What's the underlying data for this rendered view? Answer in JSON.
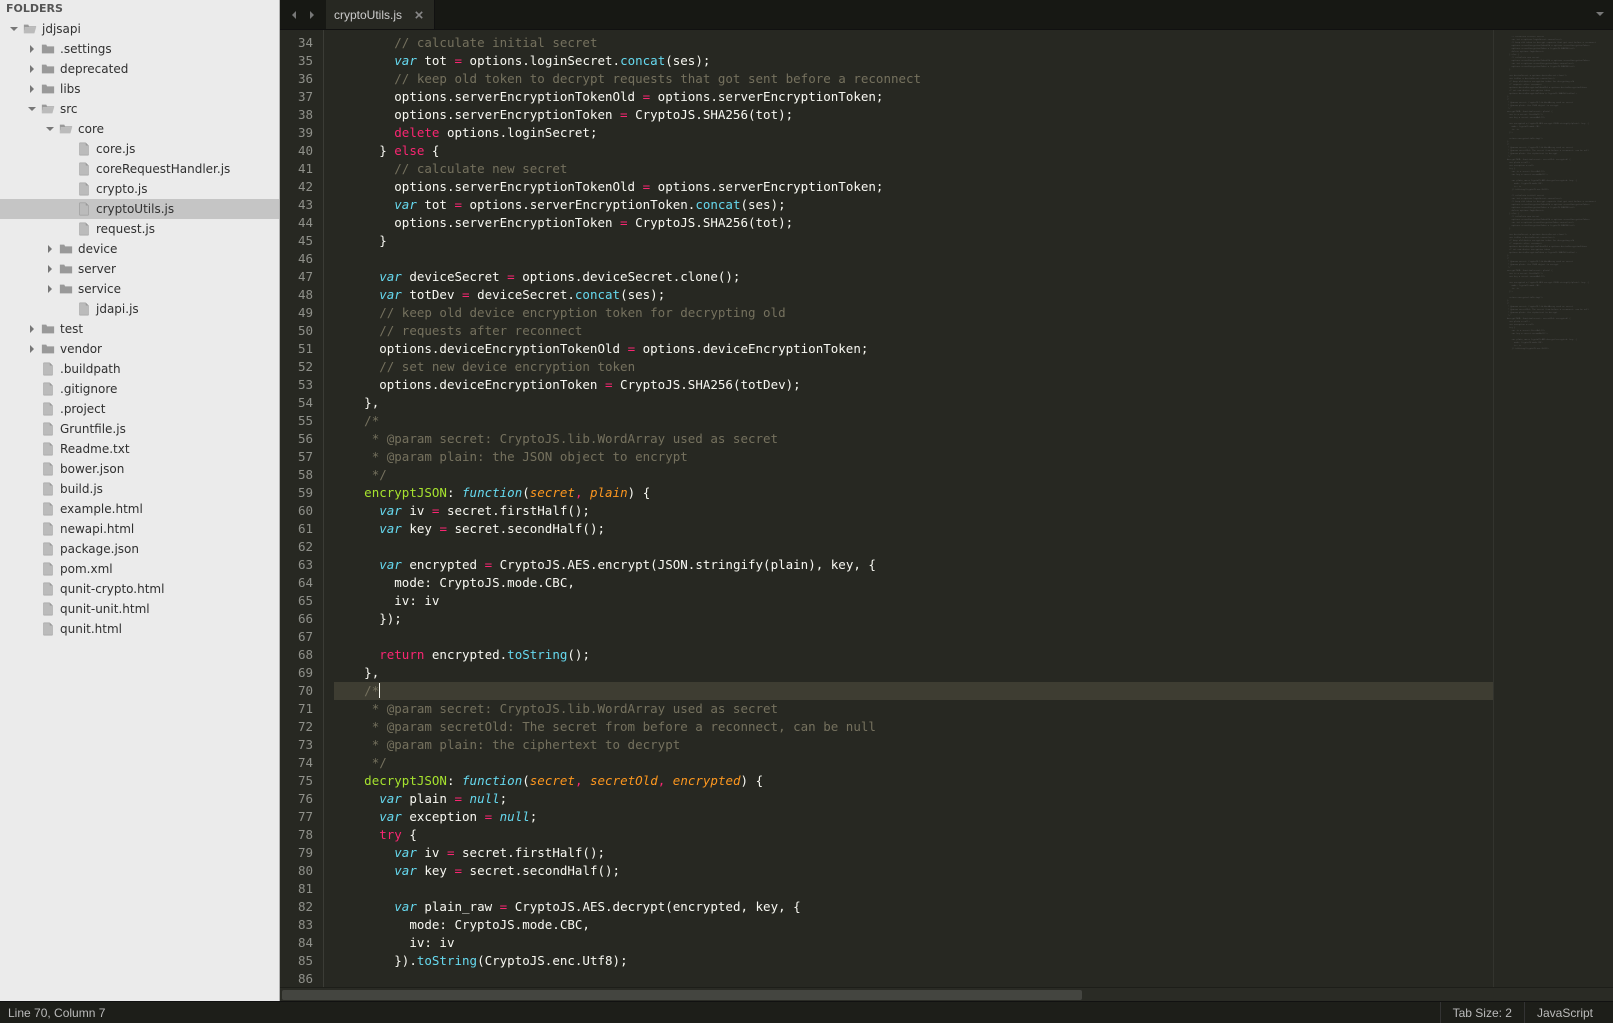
{
  "sidebar": {
    "header": "FOLDERS",
    "tree": [
      {
        "depth": 0,
        "type": "folder",
        "open": true,
        "name": "jdjsapi"
      },
      {
        "depth": 1,
        "type": "folder",
        "open": false,
        "name": ".settings"
      },
      {
        "depth": 1,
        "type": "folder",
        "open": false,
        "name": "deprecated"
      },
      {
        "depth": 1,
        "type": "folder",
        "open": false,
        "name": "libs"
      },
      {
        "depth": 1,
        "type": "folder",
        "open": true,
        "name": "src"
      },
      {
        "depth": 2,
        "type": "folder",
        "open": true,
        "name": "core"
      },
      {
        "depth": 3,
        "type": "file",
        "name": "core.js"
      },
      {
        "depth": 3,
        "type": "file",
        "name": "coreRequestHandler.js"
      },
      {
        "depth": 3,
        "type": "file",
        "name": "crypto.js"
      },
      {
        "depth": 3,
        "type": "file",
        "name": "cryptoUtils.js",
        "selected": true
      },
      {
        "depth": 3,
        "type": "file",
        "name": "request.js"
      },
      {
        "depth": 2,
        "type": "folder",
        "open": false,
        "name": "device"
      },
      {
        "depth": 2,
        "type": "folder",
        "open": false,
        "name": "server"
      },
      {
        "depth": 2,
        "type": "folder",
        "open": false,
        "name": "service"
      },
      {
        "depth": 3,
        "type": "file",
        "name": "jdapi.js"
      },
      {
        "depth": 1,
        "type": "folder",
        "open": false,
        "name": "test"
      },
      {
        "depth": 1,
        "type": "folder",
        "open": false,
        "name": "vendor"
      },
      {
        "depth": 1,
        "type": "file",
        "name": ".buildpath"
      },
      {
        "depth": 1,
        "type": "file",
        "name": ".gitignore"
      },
      {
        "depth": 1,
        "type": "file",
        "name": ".project"
      },
      {
        "depth": 1,
        "type": "file",
        "name": "Gruntfile.js"
      },
      {
        "depth": 1,
        "type": "file",
        "name": "Readme.txt"
      },
      {
        "depth": 1,
        "type": "file",
        "name": "bower.json"
      },
      {
        "depth": 1,
        "type": "file",
        "name": "build.js"
      },
      {
        "depth": 1,
        "type": "file",
        "name": "example.html"
      },
      {
        "depth": 1,
        "type": "file",
        "name": "newapi.html"
      },
      {
        "depth": 1,
        "type": "file",
        "name": "package.json"
      },
      {
        "depth": 1,
        "type": "file",
        "name": "pom.xml"
      },
      {
        "depth": 1,
        "type": "file",
        "name": "qunit-crypto.html"
      },
      {
        "depth": 1,
        "type": "file",
        "name": "qunit-unit.html"
      },
      {
        "depth": 1,
        "type": "file",
        "name": "qunit.html"
      }
    ]
  },
  "tabs": {
    "active": "cryptoUtils.js"
  },
  "editor": {
    "first_line_no": 34,
    "active_line_no": 70,
    "lines": [
      [
        [
          "        ",
          "p"
        ],
        [
          "// calculate initial secret",
          "cmt"
        ]
      ],
      [
        [
          "        ",
          "p"
        ],
        [
          "var",
          "kw"
        ],
        [
          " tot ",
          "p"
        ],
        [
          "=",
          "op"
        ],
        [
          " options.loginSecret.",
          "p"
        ],
        [
          "concat",
          "fn"
        ],
        [
          "(ses);",
          "p"
        ]
      ],
      [
        [
          "        ",
          "p"
        ],
        [
          "// keep old token to decrypt requests that got sent before a reconnect",
          "cmt"
        ]
      ],
      [
        [
          "        options.serverEncryptionTokenOld ",
          "p"
        ],
        [
          "=",
          "op"
        ],
        [
          " options.serverEncryptionToken;",
          "p"
        ]
      ],
      [
        [
          "        options.serverEncryptionToken ",
          "p"
        ],
        [
          "=",
          "op"
        ],
        [
          " CryptoJS.SHA256(tot);",
          "p"
        ]
      ],
      [
        [
          "        ",
          "p"
        ],
        [
          "delete",
          "kw2"
        ],
        [
          " options.loginSecret;",
          "p"
        ]
      ],
      [
        [
          "      } ",
          "p"
        ],
        [
          "else",
          "kw2"
        ],
        [
          " {",
          "p"
        ]
      ],
      [
        [
          "        ",
          "p"
        ],
        [
          "// calculate new secret",
          "cmt"
        ]
      ],
      [
        [
          "        options.serverEncryptionTokenOld ",
          "p"
        ],
        [
          "=",
          "op"
        ],
        [
          " options.serverEncryptionToken;",
          "p"
        ]
      ],
      [
        [
          "        ",
          "p"
        ],
        [
          "var",
          "kw"
        ],
        [
          " tot ",
          "p"
        ],
        [
          "=",
          "op"
        ],
        [
          " options.serverEncryptionToken.",
          "p"
        ],
        [
          "concat",
          "fn"
        ],
        [
          "(ses);",
          "p"
        ]
      ],
      [
        [
          "        options.serverEncryptionToken ",
          "p"
        ],
        [
          "=",
          "op"
        ],
        [
          " CryptoJS.SHA256(tot);",
          "p"
        ]
      ],
      [
        [
          "      }",
          "p"
        ]
      ],
      [
        [
          "",
          "p"
        ]
      ],
      [
        [
          "      ",
          "p"
        ],
        [
          "var",
          "kw"
        ],
        [
          " deviceSecret ",
          "p"
        ],
        [
          "=",
          "op"
        ],
        [
          " options.deviceSecret.clone();",
          "p"
        ]
      ],
      [
        [
          "      ",
          "p"
        ],
        [
          "var",
          "kw"
        ],
        [
          " totDev ",
          "p"
        ],
        [
          "=",
          "op"
        ],
        [
          " deviceSecret.",
          "p"
        ],
        [
          "concat",
          "fn"
        ],
        [
          "(ses);",
          "p"
        ]
      ],
      [
        [
          "      ",
          "p"
        ],
        [
          "// keep old device encryption token for decrypting old",
          "cmt"
        ]
      ],
      [
        [
          "      ",
          "p"
        ],
        [
          "// requests after reconnect",
          "cmt"
        ]
      ],
      [
        [
          "      options.deviceEncryptionTokenOld ",
          "p"
        ],
        [
          "=",
          "op"
        ],
        [
          " options.deviceEncryptionToken;",
          "p"
        ]
      ],
      [
        [
          "      ",
          "p"
        ],
        [
          "// set new device encryption token",
          "cmt"
        ]
      ],
      [
        [
          "      options.deviceEncryptionToken ",
          "p"
        ],
        [
          "=",
          "op"
        ],
        [
          " CryptoJS.SHA256(totDev);",
          "p"
        ]
      ],
      [
        [
          "    },",
          "p"
        ]
      ],
      [
        [
          "    ",
          "p"
        ],
        [
          "/*",
          "cmt"
        ]
      ],
      [
        [
          "     * @param secret: CryptoJS.lib.WordArray used as secret",
          "cmt"
        ]
      ],
      [
        [
          "     * @param plain: the JSON object to encrypt",
          "cmt"
        ]
      ],
      [
        [
          "     */",
          "cmt"
        ]
      ],
      [
        [
          "    ",
          "p"
        ],
        [
          "encryptJSON",
          "name"
        ],
        [
          ": ",
          "p"
        ],
        [
          "function",
          "kw"
        ],
        [
          "(",
          "p"
        ],
        [
          "secret",
          "arg"
        ],
        [
          ",",
          "op"
        ],
        [
          " ",
          "p"
        ],
        [
          "plain",
          "arg"
        ],
        [
          ") {",
          "p"
        ]
      ],
      [
        [
          "      ",
          "p"
        ],
        [
          "var",
          "kw"
        ],
        [
          " iv ",
          "p"
        ],
        [
          "=",
          "op"
        ],
        [
          " secret.firstHalf();",
          "p"
        ]
      ],
      [
        [
          "      ",
          "p"
        ],
        [
          "var",
          "kw"
        ],
        [
          " key ",
          "p"
        ],
        [
          "=",
          "op"
        ],
        [
          " secret.secondHalf();",
          "p"
        ]
      ],
      [
        [
          "",
          "p"
        ]
      ],
      [
        [
          "      ",
          "p"
        ],
        [
          "var",
          "kw"
        ],
        [
          " encrypted ",
          "p"
        ],
        [
          "=",
          "op"
        ],
        [
          " CryptoJS.AES.encrypt(JSON.stringify(plain), key, {",
          "p"
        ]
      ],
      [
        [
          "        mode: CryptoJS.mode.CBC,",
          "p"
        ]
      ],
      [
        [
          "        iv: iv",
          "p"
        ]
      ],
      [
        [
          "      });",
          "p"
        ]
      ],
      [
        [
          "",
          "p"
        ]
      ],
      [
        [
          "      ",
          "p"
        ],
        [
          "return",
          "kw2"
        ],
        [
          " encrypted.",
          "p"
        ],
        [
          "toString",
          "fn"
        ],
        [
          "();",
          "p"
        ]
      ],
      [
        [
          "    },",
          "p"
        ]
      ],
      [
        [
          "    ",
          "p"
        ],
        [
          "/*",
          "cmt"
        ],
        [
          "CURSOR",
          ""
        ]
      ],
      [
        [
          "     * @param secret: CryptoJS.lib.WordArray used as secret",
          "cmt"
        ]
      ],
      [
        [
          "     * @param secretOld: The secret from before a reconnect, can be null",
          "cmt"
        ]
      ],
      [
        [
          "     * @param plain: the ciphertext to decrypt",
          "cmt"
        ]
      ],
      [
        [
          "     */",
          "cmt"
        ]
      ],
      [
        [
          "    ",
          "p"
        ],
        [
          "decryptJSON",
          "name"
        ],
        [
          ": ",
          "p"
        ],
        [
          "function",
          "kw"
        ],
        [
          "(",
          "p"
        ],
        [
          "secret",
          "arg"
        ],
        [
          ",",
          "op"
        ],
        [
          " ",
          "p"
        ],
        [
          "secretOld",
          "arg"
        ],
        [
          ",",
          "op"
        ],
        [
          " ",
          "p"
        ],
        [
          "encrypted",
          "arg"
        ],
        [
          ") {",
          "p"
        ]
      ],
      [
        [
          "      ",
          "p"
        ],
        [
          "var",
          "kw"
        ],
        [
          " plain ",
          "p"
        ],
        [
          "=",
          "op"
        ],
        [
          " ",
          "p"
        ],
        [
          "null",
          "kw"
        ],
        [
          ";",
          "p"
        ]
      ],
      [
        [
          "      ",
          "p"
        ],
        [
          "var",
          "kw"
        ],
        [
          " exception ",
          "p"
        ],
        [
          "=",
          "op"
        ],
        [
          " ",
          "p"
        ],
        [
          "null",
          "kw"
        ],
        [
          ";",
          "p"
        ]
      ],
      [
        [
          "      ",
          "p"
        ],
        [
          "try",
          "kw2"
        ],
        [
          " {",
          "p"
        ]
      ],
      [
        [
          "        ",
          "p"
        ],
        [
          "var",
          "kw"
        ],
        [
          " iv ",
          "p"
        ],
        [
          "=",
          "op"
        ],
        [
          " secret.firstHalf();",
          "p"
        ]
      ],
      [
        [
          "        ",
          "p"
        ],
        [
          "var",
          "kw"
        ],
        [
          " key ",
          "p"
        ],
        [
          "=",
          "op"
        ],
        [
          " secret.secondHalf();",
          "p"
        ]
      ],
      [
        [
          "",
          "p"
        ]
      ],
      [
        [
          "        ",
          "p"
        ],
        [
          "var",
          "kw"
        ],
        [
          " plain_raw ",
          "p"
        ],
        [
          "=",
          "op"
        ],
        [
          " CryptoJS.AES.decrypt(encrypted, key, {",
          "p"
        ]
      ],
      [
        [
          "          mode: CryptoJS.mode.CBC,",
          "p"
        ]
      ],
      [
        [
          "          iv: iv",
          "p"
        ]
      ],
      [
        [
          "        }).",
          "p"
        ],
        [
          "toString",
          "fn"
        ],
        [
          "(CryptoJS.enc.Utf8);",
          "p"
        ]
      ],
      [
        [
          "",
          "p"
        ]
      ]
    ]
  },
  "status": {
    "left": "Line 70, Column 7",
    "tabsize": "Tab Size: 2",
    "lang": "JavaScript"
  }
}
